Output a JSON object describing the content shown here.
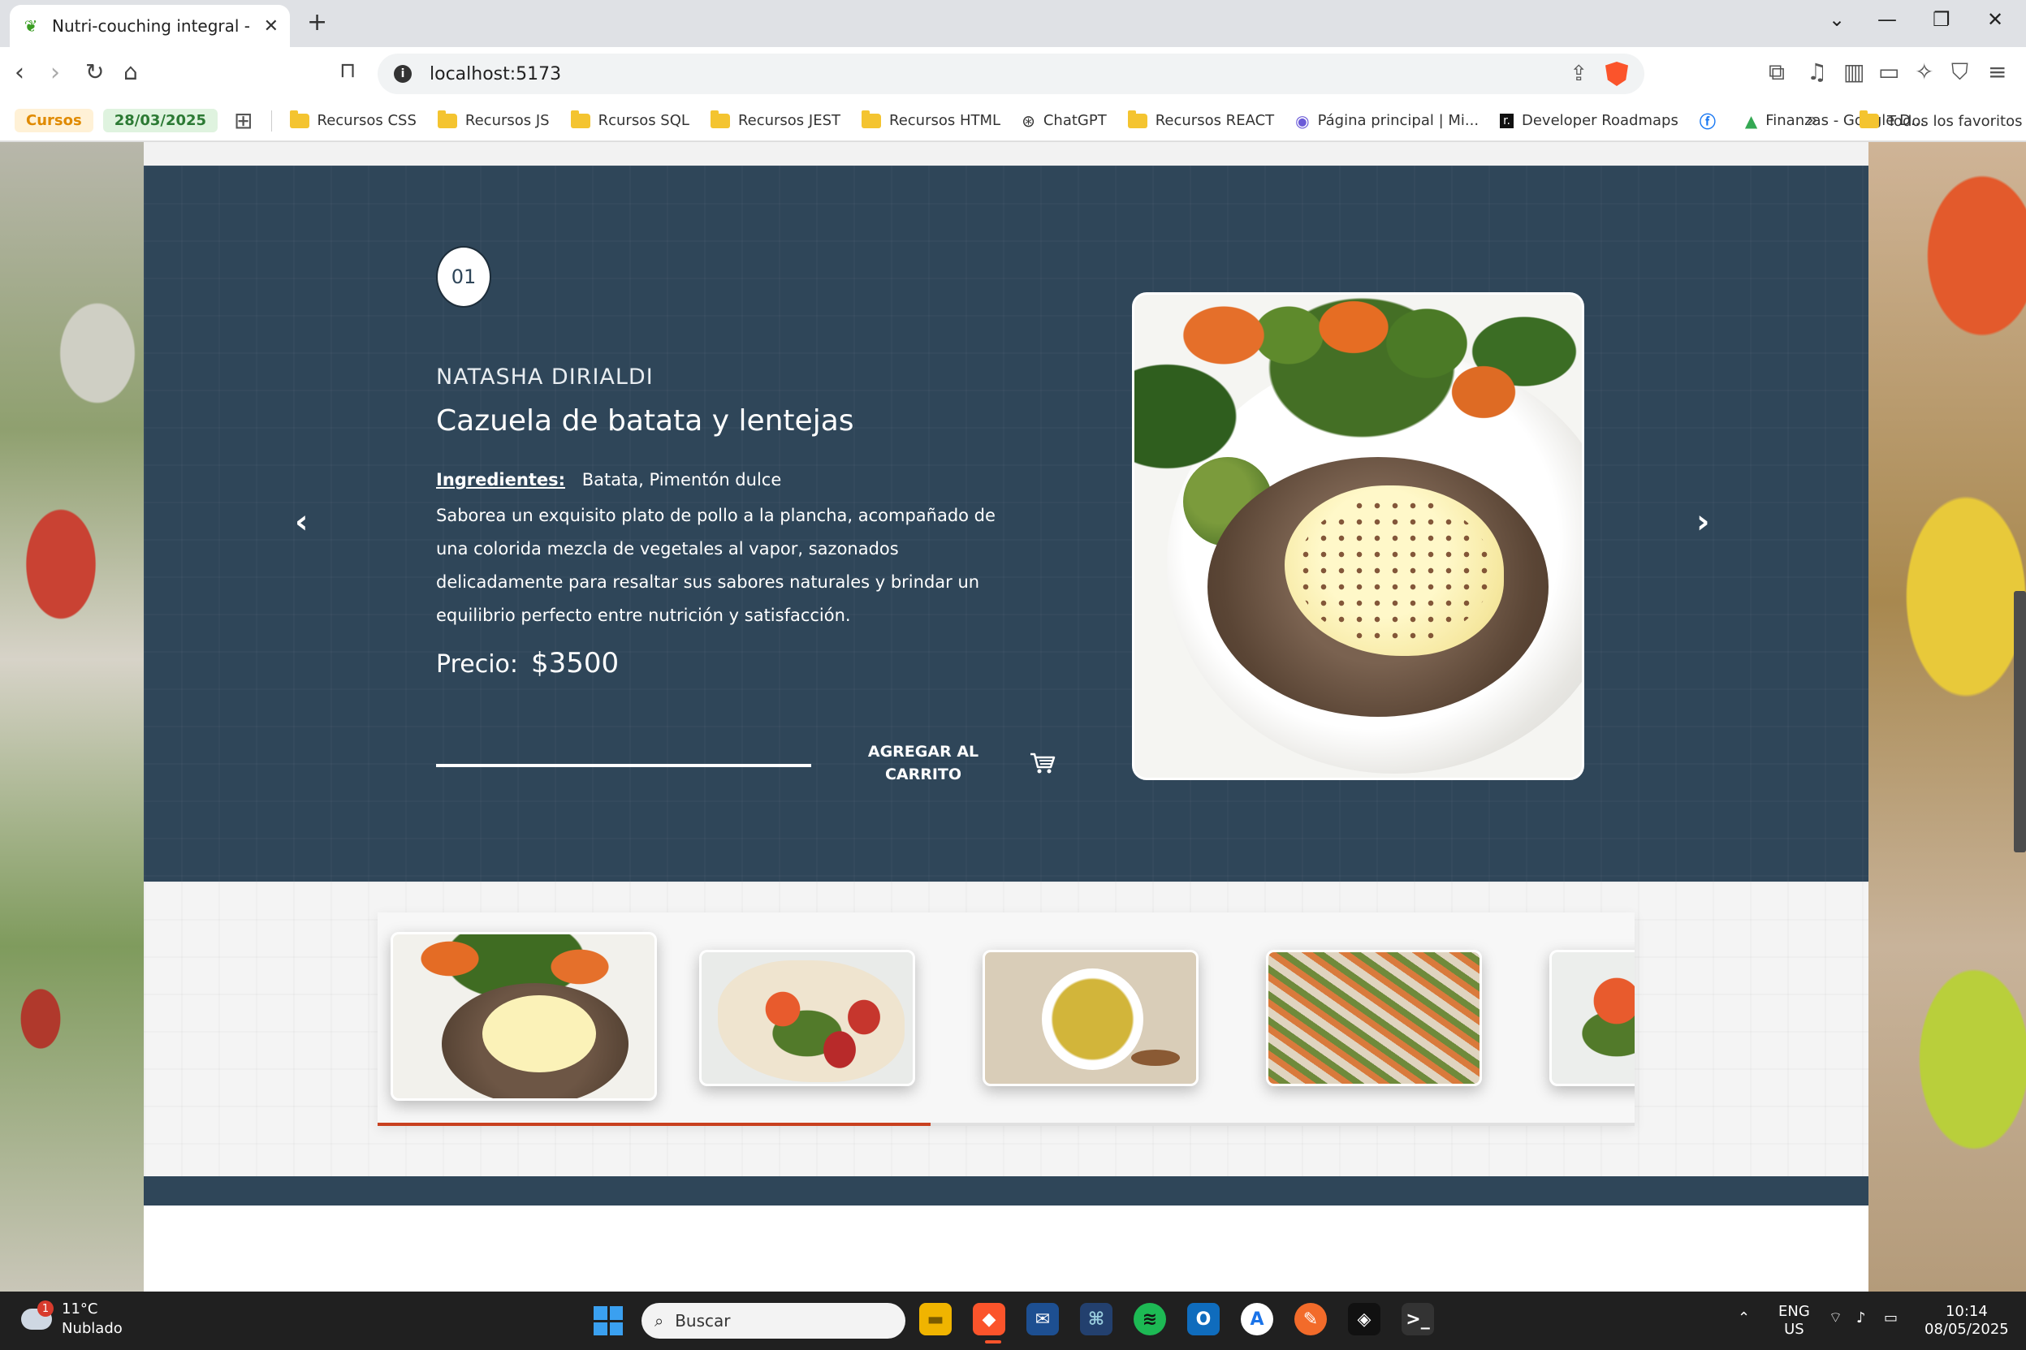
{
  "browser": {
    "tab_title": "Nutri-couching integral - Natas",
    "new_tab_label": "+",
    "url": "localhost:5173",
    "window_controls": [
      "chevron-down",
      "minimize",
      "restore",
      "close"
    ]
  },
  "bookmarks": {
    "chip_cursos": "Cursos",
    "chip_date": "28/03/2025",
    "items": [
      {
        "label": "Recursos CSS",
        "icon": "folder-icon"
      },
      {
        "label": "Recursos JS",
        "icon": "folder-icon"
      },
      {
        "label": "Rcursos SQL",
        "icon": "folder-icon"
      },
      {
        "label": "Recursos JEST",
        "icon": "folder-icon"
      },
      {
        "label": "Recursos HTML",
        "icon": "folder-icon"
      },
      {
        "label": "ChatGPT",
        "icon": "chatgpt-icon"
      },
      {
        "label": "Recursos REACT",
        "icon": "folder-icon"
      },
      {
        "label": "Página principal | Mi...",
        "icon": "copilot-icon"
      },
      {
        "label": "Developer Roadmaps",
        "icon": "roadmap-icon"
      },
      {
        "label": "",
        "icon": "facebook-icon"
      },
      {
        "label": "Finanzas - Google D...",
        "icon": "google-drive-icon"
      }
    ],
    "more": "»",
    "all_favorites": "Todos los favoritos"
  },
  "slide": {
    "number": "01",
    "author": "NATASHA DIRIALDI",
    "title": "Cazuela de batata y lentejas",
    "ingredients_label": "Ingredientes:",
    "ingredients": "Batata, Pimentón dulce",
    "description": "Saborea un exquisito plato de pollo a la plancha, acompañado de una colorida mezcla de vegetales al vapor, sazonados delicadamente para resaltar sus sabores naturales y brindar un equilibrio perfecto entre nutrición y satisfacción.",
    "price_label": "Precio:",
    "price_value": "$3500",
    "add_to_cart_line1": "AGREGAR AL",
    "add_to_cart_line2": "CARRITO",
    "prev_arrow": "‹",
    "next_arrow": "›"
  },
  "thumbnails": {
    "items": [
      {
        "name": "lentil-patty"
      },
      {
        "name": "veggie-wrap"
      },
      {
        "name": "rice-bowl"
      },
      {
        "name": "meal-prep-containers"
      },
      {
        "name": "veggie-wrap-partial"
      }
    ],
    "progress": 0.44
  },
  "taskbar": {
    "weather_temp": "11°C",
    "weather_desc": "Nublado",
    "weather_badge": "1",
    "search_placeholder": "Buscar",
    "lang_line1": "ENG",
    "lang_line2": "US",
    "time": "10:14",
    "date": "08/05/2025"
  },
  "colors": {
    "hero_bg": "#2f4659",
    "accent_progress": "#c8401f",
    "brave_orange": "#fb542b"
  }
}
